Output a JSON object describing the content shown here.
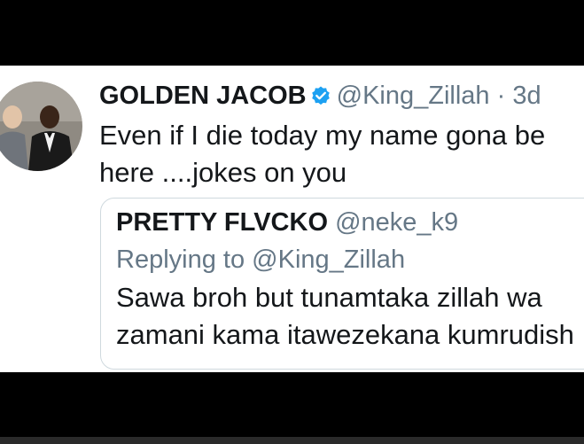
{
  "tweet": {
    "display_name": "GOLDEN JACOB",
    "handle": "@King_Zillah",
    "separator": "·",
    "time": "3d",
    "text": "Even if I die today my name gona be here ....jokes on you"
  },
  "quoted_tweet": {
    "display_name": "PRETTY FLVCKO",
    "handle": "@neke_k9",
    "replying_label": "Replying to",
    "replying_handle": "@King_Zillah",
    "text_line1": "Sawa broh but tunamtaka zillah wa",
    "text_line2": "zamani kama itawezekana kumrudish"
  },
  "colors": {
    "name": "#14171a",
    "secondary": "#657786",
    "verified": "#1da1f2",
    "card_border": "#cfd9de"
  },
  "icons": {
    "verified": "verified-badge-icon",
    "avatar": "avatar"
  }
}
